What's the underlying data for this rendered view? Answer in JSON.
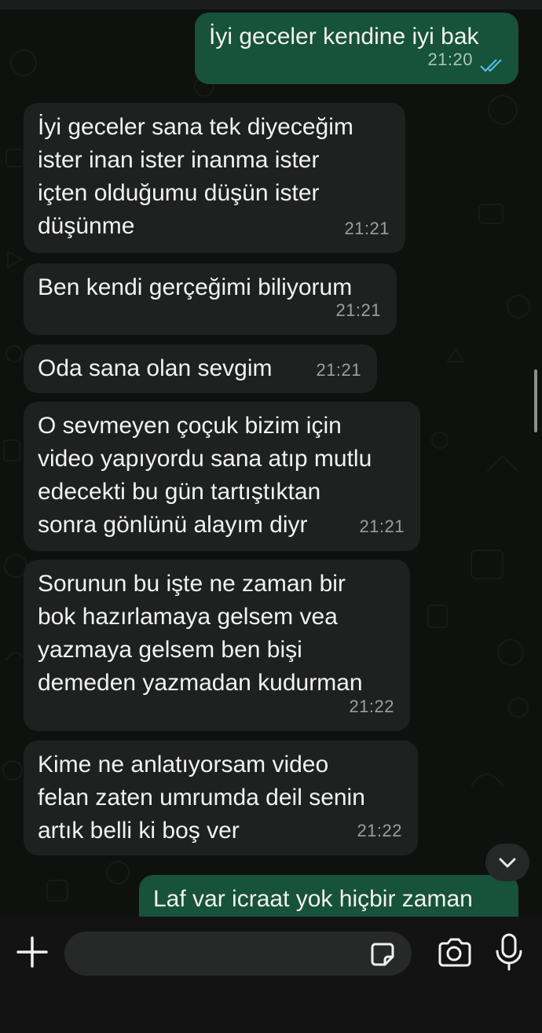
{
  "messages": [
    {
      "direction": "out",
      "text": "İyi geceler kendine iyi bak",
      "time": "21:20",
      "read": true
    },
    {
      "direction": "in",
      "text": "İyi geceler sana tek diyeceğim\nister inan ister inanma ister\niçten olduğumu düşün ister\ndüşünme",
      "time": "21:21"
    },
    {
      "direction": "in",
      "text": "Ben kendi gerçeğimi biliyorum",
      "time": "21:21"
    },
    {
      "direction": "in",
      "text": "Oda sana olan sevgim",
      "time": "21:21"
    },
    {
      "direction": "in",
      "text": "O sevmeyen çoçuk bizim için\nvideo yapıyordu sana atıp mutlu\nedecekti bu gün tartıştıktan\nsonra gönlünü alayım diyr",
      "time": "21:21"
    },
    {
      "direction": "in",
      "text": "Sorunun bu işte ne zaman bir\nbok hazırlamaya gelsem vea\nyazmaya gelsem ben bişi\ndemeden yazmadan kudurman",
      "time": "21:22"
    },
    {
      "direction": "in",
      "text": "Kime ne anlatıyorsam video\nfelan zaten umrumda deil senin\nartık belli ki boş ver",
      "time": "21:22"
    },
    {
      "direction": "out",
      "text": "Laf var icraat yok hiçbir zaman",
      "time": ""
    }
  ],
  "composer": {
    "input_value": "",
    "plus_icon": "plus-icon",
    "sticker_icon": "sticker-icon",
    "camera_icon": "camera-icon",
    "mic_icon": "microphone-icon"
  },
  "colors": {
    "incoming_bubble": "#1f2120",
    "outgoing_bubble": "#17523a",
    "read_ticks": "#53bdeb"
  }
}
